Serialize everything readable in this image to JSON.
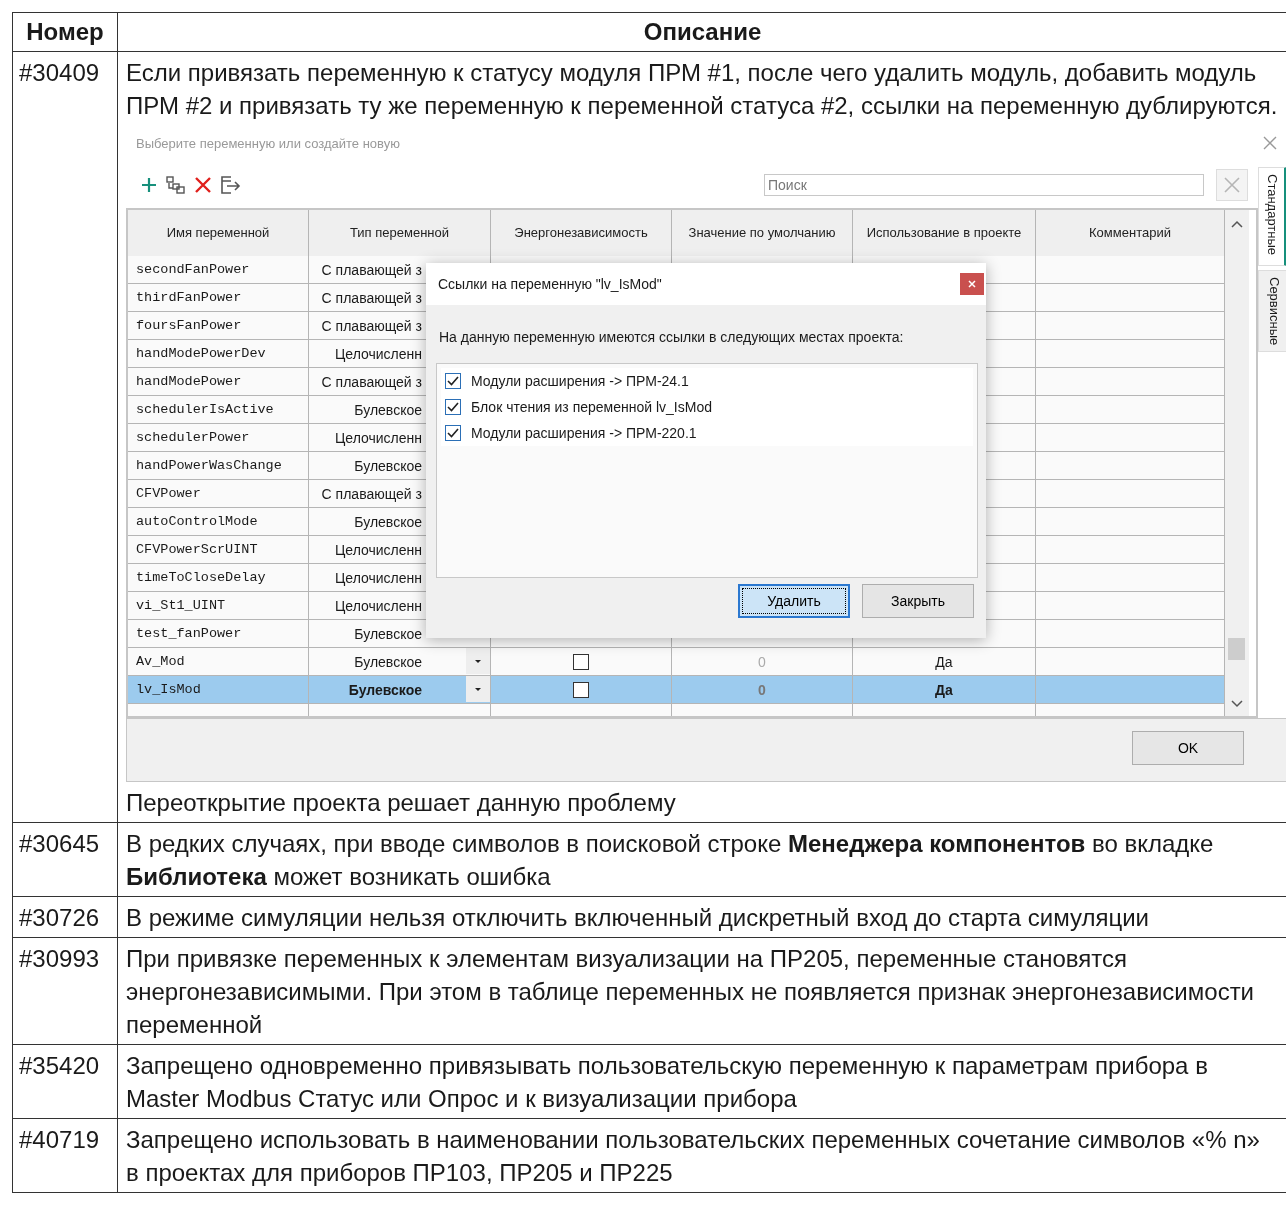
{
  "table": {
    "columns": [
      "Номер",
      "Описание"
    ],
    "rows": [
      {
        "number": "#30409",
        "blocks": [
          {
            "kind": "paragraph",
            "text": "Если привязать переменную к статусу модуля ПРМ #1, после чего удалить модуль, добавить модуль ПРМ #2 и привязать ту же переменную к переменной статуса #2, ссылки на переменную дублируются."
          },
          {
            "kind": "window",
            "title": "Выберите переменную или создайте новую",
            "search": {
              "placeholder": "Поиск"
            },
            "side_tabs": [
              {
                "label": "Стандартные",
                "selected": true
              },
              {
                "label": "Сервисные",
                "selected": false
              }
            ],
            "grid": {
              "columns": [
                "Имя переменной",
                "Тип переменной",
                "Энергонезависимость",
                "Значение по умолчанию",
                "Использование в проекте",
                "Комментарий"
              ],
              "rows": [
                {
                  "kind": "covered",
                  "name": "secondFanPower",
                  "type": "С плавающей з",
                  "selected": false
                },
                {
                  "kind": "covered",
                  "name": "thirdFanPower",
                  "type": "С плавающей з",
                  "selected": false
                },
                {
                  "kind": "covered",
                  "name": "foursFanPower",
                  "type": "С плавающей з",
                  "selected": false
                },
                {
                  "kind": "covered",
                  "name": "handModePowerDev",
                  "type": "Целочисленн",
                  "selected": false
                },
                {
                  "kind": "covered",
                  "name": "handModePower",
                  "type": "С плавающей з",
                  "selected": false
                },
                {
                  "kind": "covered",
                  "name": "schedulerIsActive",
                  "type": "Булевское",
                  "selected": false
                },
                {
                  "kind": "covered",
                  "name": "schedulerPower",
                  "type": "Целочисленн",
                  "selected": false
                },
                {
                  "kind": "covered",
                  "name": "handPowerWasChange",
                  "type": "Булевское",
                  "selected": false
                },
                {
                  "kind": "covered",
                  "name": "CFVPower",
                  "type": "С плавающей з",
                  "selected": false
                },
                {
                  "kind": "covered",
                  "name": "autoControlMode",
                  "type": "Булевское",
                  "selected": false
                },
                {
                  "kind": "covered",
                  "name": "CFVPowerScrUINT",
                  "type": "Целочисленн",
                  "selected": false
                },
                {
                  "kind": "covered",
                  "name": "timeToCloseDelay",
                  "type": "Целочисленн",
                  "selected": false
                },
                {
                  "kind": "covered",
                  "name": "vi_St1_UINT",
                  "type": "Целочисленн",
                  "selected": false
                },
                {
                  "kind": "covered",
                  "name": "test_fanPower",
                  "type": "Булевское",
                  "selected": false
                },
                {
                  "kind": "full",
                  "name": "Av_Mod",
                  "type": "Булевское",
                  "energy": false,
                  "default": "0",
                  "usage": "Да",
                  "selected": false
                },
                {
                  "kind": "full",
                  "name": "lv_IsMod",
                  "type": "Булевское",
                  "energy": false,
                  "default": "0",
                  "usage": "Да",
                  "selected": true
                }
              ]
            },
            "ok_button": "OK",
            "dialog": {
              "title": "Ссылки на переменную \"lv_IsMod\"",
              "message": "На данную переменную имеются ссылки в следующих местах проекта:",
              "items": [
                {
                  "label": "Модули расширения -> ПРМ-24.1",
                  "checked": true
                },
                {
                  "label": "Блок чтения из переменной lv_IsMod",
                  "checked": true
                },
                {
                  "label": "Модули расширения -> ПРМ-220.1",
                  "checked": true
                }
              ],
              "buttons": [
                {
                  "label": "Удалить",
                  "focused": true
                },
                {
                  "label": "Закрыть",
                  "focused": false
                }
              ]
            }
          },
          {
            "kind": "paragraph",
            "text": "Переоткрытие проекта решает данную проблему"
          }
        ]
      },
      {
        "number": "#30645",
        "blocks": [
          {
            "kind": "paragraph",
            "text": "В редких случаях, при вводе символов в поисковой строке **Менеджера компонентов** во вкладке **Библиотека** может возникать ошибка"
          }
        ]
      },
      {
        "number": "#30726",
        "blocks": [
          {
            "kind": "paragraph",
            "text": "В режиме симуляции нельзя отключить включенный дискретный вход до старта симуляции"
          }
        ]
      },
      {
        "number": "#30993",
        "blocks": [
          {
            "kind": "paragraph",
            "text": "При привязке переменных к элементам визуализации на ПР205, переменные становятся энергонезависимыми. При этом в таблице переменных не появляется признак энергонезависимости переменной"
          }
        ]
      },
      {
        "number": "#35420",
        "blocks": [
          {
            "kind": "paragraph",
            "text": "Запрещено одновременно привязывать пользовательскую переменную к параметрам прибора в Master Modbus Статус или Опрос и к визуализации прибора"
          }
        ]
      },
      {
        "number": "#40719",
        "blocks": [
          {
            "kind": "paragraph",
            "text": "Запрещено использовать в наименовании пользовательских переменных сочетание символов «% n» в проектах для приборов ПР103, ПР205 и ПР225"
          }
        ]
      }
    ]
  }
}
